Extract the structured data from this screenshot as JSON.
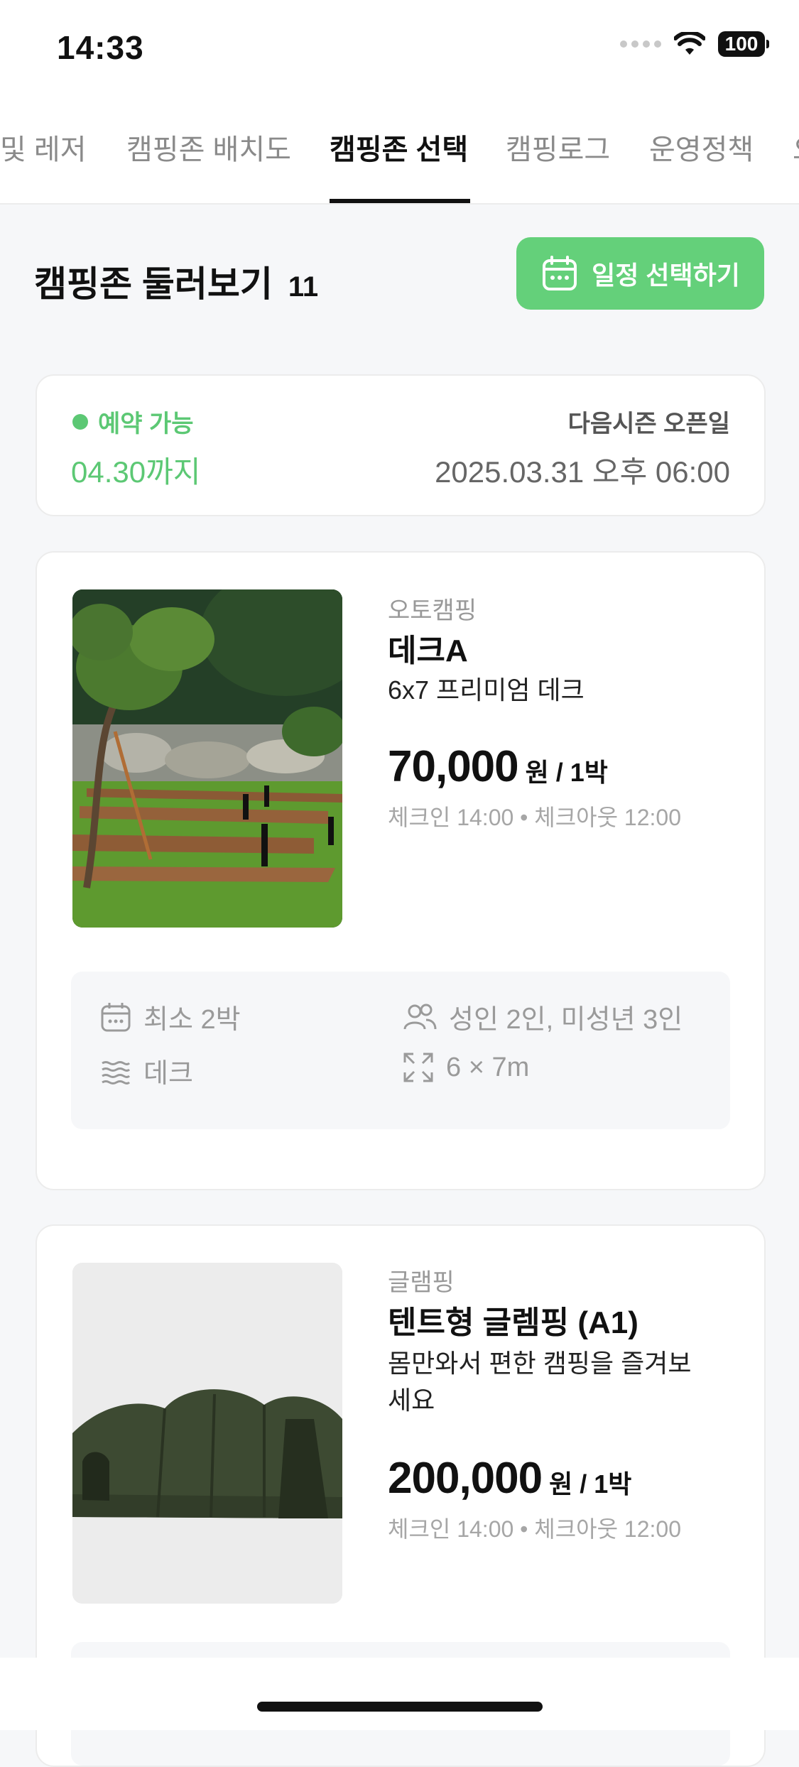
{
  "status": {
    "time": "14:33",
    "battery": "100"
  },
  "tabs": [
    {
      "label": "및 레저"
    },
    {
      "label": "캠핑존 배치도"
    },
    {
      "label": "캠핑존 선택"
    },
    {
      "label": "캠핑로그"
    },
    {
      "label": "운영정책"
    },
    {
      "label": "오"
    }
  ],
  "section": {
    "title": "캠핑존 둘러보기",
    "count": "11",
    "schedule_button": "일정 선택하기"
  },
  "season": {
    "status": "예약 가능",
    "until": "04.30까지",
    "next_label": "다음시즌 오픈일",
    "next_date": "2025.03.31 오후 06:00"
  },
  "sites": [
    {
      "type": "오토캠핑",
      "name": "데크A",
      "description": "6x7 프리미엄 데크",
      "price": "70,000",
      "unit": "원 / 1박",
      "checkin": "체크인 14:00 • 체크아웃 12:00",
      "features": {
        "min_nights": "최소 2박",
        "capacity": "성인 2인, 미성년 3인",
        "floor": "데크",
        "size": "6 × 7m"
      }
    },
    {
      "type": "글램핑",
      "name": "텐트형 글렘핑 (A1)",
      "description": "몸만와서 편한 캠핑을 즐겨보세요",
      "price": "200,000",
      "unit": "원 / 1박",
      "checkin": "체크인 14:00 • 체크아웃 12:00"
    }
  ],
  "colors": {
    "accent": "#64d07a",
    "available": "#5cc874"
  }
}
